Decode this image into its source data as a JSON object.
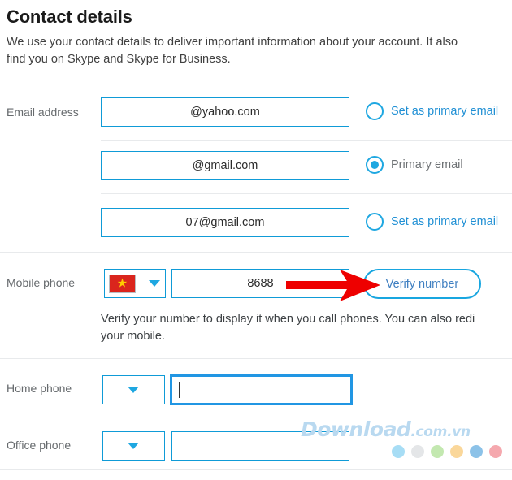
{
  "page": {
    "title": "Contact details",
    "description_line1": "We use your contact details to deliver important information about your account. It also",
    "description_line2": "find you on Skype and Skype for Business."
  },
  "email_section": {
    "label": "Email address",
    "rows": [
      {
        "value": "@yahoo.com",
        "radio_label": "Set as primary email",
        "checked": false
      },
      {
        "value": "@gmail.com",
        "radio_label": "Primary email",
        "checked": true
      },
      {
        "value": "07@gmail.com",
        "radio_label": "Set as primary email",
        "checked": false
      }
    ]
  },
  "mobile_section": {
    "label": "Mobile phone",
    "country_flag": "vietnam-flag",
    "country_star": "★",
    "number": "8688",
    "verify_button": "Verify number",
    "help_line1": "Verify your number to display it when you call phones. You can also redi",
    "help_line2": "your mobile."
  },
  "home_section": {
    "label": "Home phone",
    "value": "",
    "placeholder": "",
    "focused": true
  },
  "office_section": {
    "label": "Office phone",
    "value": "",
    "placeholder": ""
  },
  "annotation": {
    "type": "red-arrow",
    "color": "#ee0000",
    "points_to": "Verify number"
  },
  "watermark": {
    "brand": "Download",
    "suffix": ".com.vn",
    "color": "#b9d9f0",
    "dot_colors": [
      "#a7ddf5",
      "#e4e6e8",
      "#c3e8b0",
      "#fad79a",
      "#8cc2e8",
      "#f5a8ae"
    ]
  },
  "colors": {
    "accent": "#0f9bd7",
    "focus": "#2196e3",
    "link": "#1f8fd4",
    "divider": "#e8eaec",
    "flag_red": "#da251d",
    "flag_star": "#ffcd00"
  }
}
